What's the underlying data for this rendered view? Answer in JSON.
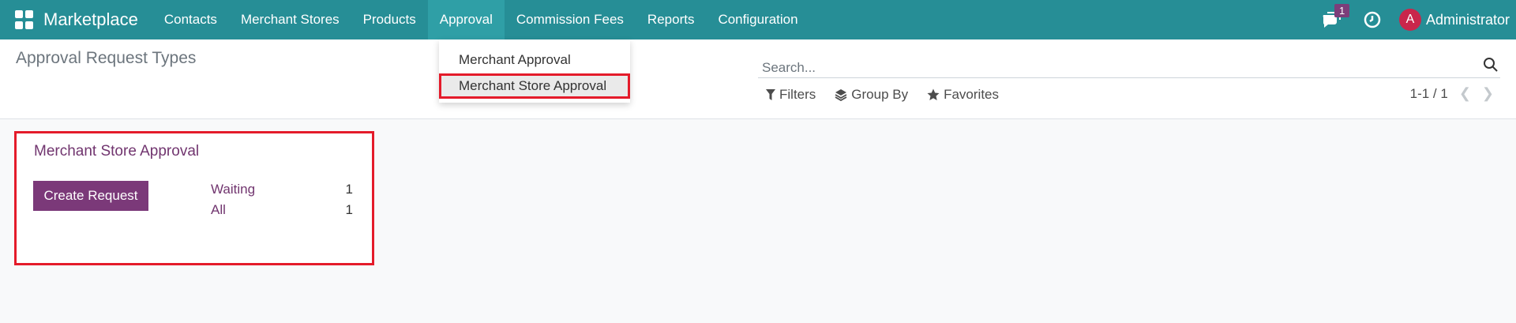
{
  "navbar": {
    "brand": "Marketplace",
    "menu": [
      "Contacts",
      "Merchant Stores",
      "Products",
      "Approval",
      "Commission Fees",
      "Reports",
      "Configuration"
    ],
    "active_index": 3,
    "chat_count": "1",
    "avatar_letter": "A",
    "user_name": "Administrator",
    "colors": {
      "bar": "#268e96",
      "badge": "#7c3d7a",
      "avatar": "#c9264b"
    }
  },
  "dropdown": {
    "items": [
      "Merchant Approval",
      "Merchant Store Approval"
    ],
    "highlighted_index": 1
  },
  "control": {
    "title": "Approval Request Types",
    "search_placeholder": "Search...",
    "filters_label": "Filters",
    "groupby_label": "Group By",
    "favorites_label": "Favorites",
    "pager": "1-1 / 1"
  },
  "card": {
    "title": "Merchant Store Approval",
    "button_label": "Create Request",
    "waiting_label": "Waiting",
    "waiting_count": "1",
    "all_label": "All",
    "all_count": "1"
  },
  "highlight_color": "#e41b2a"
}
